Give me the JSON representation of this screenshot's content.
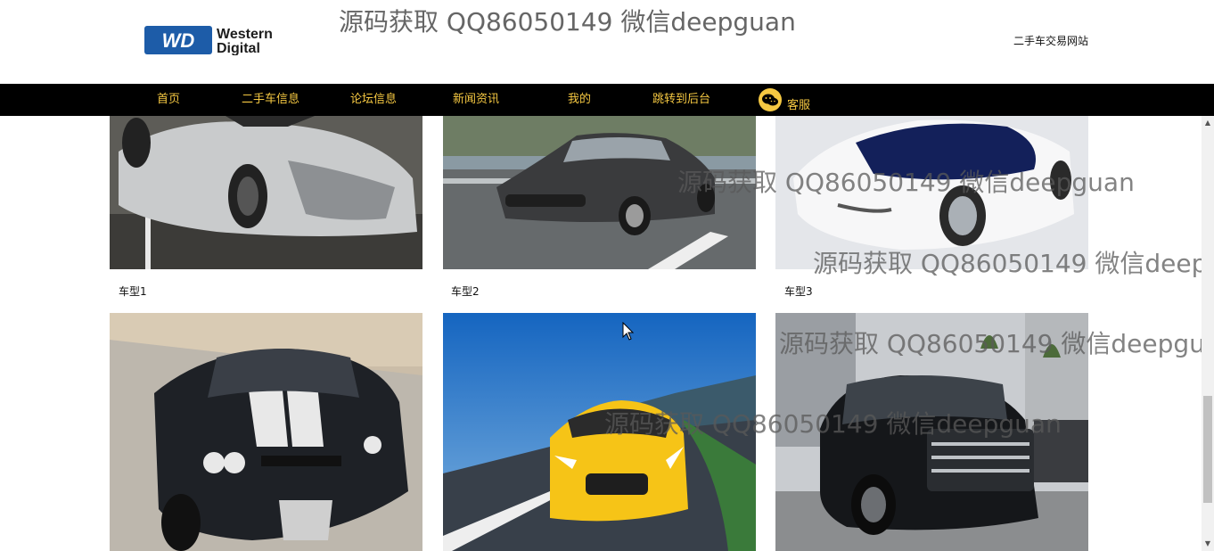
{
  "header": {
    "logo_line1": "Western",
    "logo_line2": "Digital",
    "logo_badge": "WD",
    "watermark": "源码获取 QQ86050149 微信deepguan",
    "site_name": "二手车交易网站"
  },
  "nav": {
    "items": [
      {
        "label": "首页"
      },
      {
        "label": "二手车信息"
      },
      {
        "label": "论坛信息"
      },
      {
        "label": "新闻资讯"
      },
      {
        "label": "我的"
      },
      {
        "label": "跳转到后台"
      }
    ],
    "kefu_label": "客服"
  },
  "cars": [
    {
      "caption": "车型1",
      "image": "silver-sports-car-photo"
    },
    {
      "caption": "车型2",
      "image": "dark-gray-sedan-photo"
    },
    {
      "caption": "车型3",
      "image": "white-concept-car-photo"
    },
    {
      "caption": "",
      "image": "black-muscle-car-photo"
    },
    {
      "caption": "",
      "image": "yellow-sports-coupe-photo"
    },
    {
      "caption": "",
      "image": "black-suv-photo"
    }
  ],
  "overlay_watermarks": [
    "源码获取 QQ86050149 微信deepguan",
    "源码获取 QQ86050149 微信deepguan",
    "源码获取 QQ86050149 微信deepguan",
    "源码获取 QQ86050149 微信deepguan"
  ],
  "colors": {
    "nav_bg": "#000000",
    "nav_text": "#f5c842",
    "logo_blue": "#1d5ca8"
  }
}
